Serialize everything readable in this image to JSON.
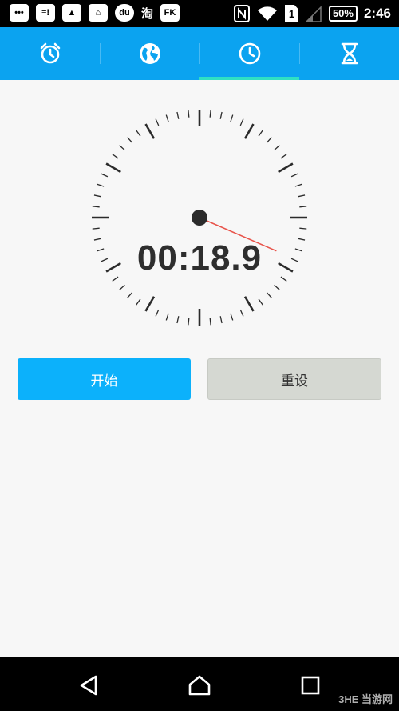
{
  "status_bar": {
    "left_icons": [
      {
        "name": "message-icon",
        "glyph": "•••"
      },
      {
        "name": "chat-icon",
        "glyph": "≡!"
      },
      {
        "name": "gallery-icon",
        "glyph": "▲"
      },
      {
        "name": "car-icon",
        "glyph": "⌂"
      },
      {
        "name": "baidu-icon",
        "glyph": "du"
      },
      {
        "name": "taobao-icon",
        "text": "淘"
      },
      {
        "name": "fk-icon",
        "glyph": "FK"
      }
    ],
    "sim_label": "1",
    "battery": "50%",
    "time": "2:46"
  },
  "tabs": [
    {
      "name": "tab-alarm",
      "icon": "alarm-clock-icon",
      "active": false
    },
    {
      "name": "tab-world-clock",
      "icon": "globe-icon",
      "active": false
    },
    {
      "name": "tab-stopwatch",
      "icon": "clock-icon",
      "active": true
    },
    {
      "name": "tab-timer",
      "icon": "hourglass-icon",
      "active": false
    }
  ],
  "stopwatch": {
    "elapsed": "00:18.9",
    "elapsed_seconds": 18.9,
    "hand_color": "#e8534a"
  },
  "buttons": {
    "start_label": "开始",
    "reset_label": "重设"
  },
  "colors": {
    "accent": "#0ba3f0",
    "tab_indicator": "#2fe0c3",
    "start_button": "#0cb1fb",
    "reset_button": "#d5d8d2"
  },
  "watermark": "3HE 当游网"
}
